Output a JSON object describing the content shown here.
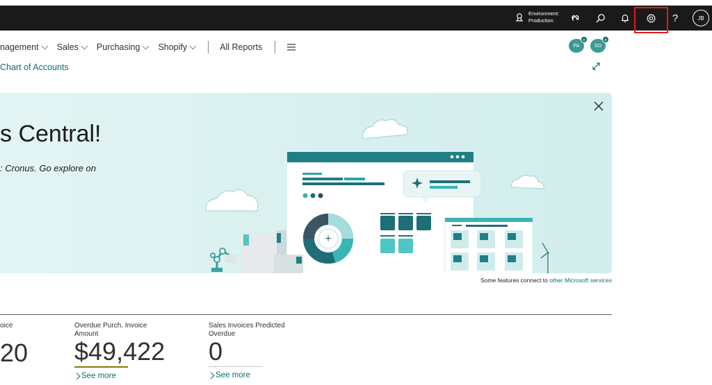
{
  "topbar": {
    "env_label": "Environment:",
    "env_value": "Production",
    "avatar_initials": "JB",
    "help_glyph": "?"
  },
  "nav": {
    "items": [
      {
        "label": "nagement"
      },
      {
        "label": "Sales"
      },
      {
        "label": "Purchasing"
      },
      {
        "label": "Shopify"
      }
    ],
    "all_reports": "All Reports",
    "sub_link": "Chart of Accounts"
  },
  "badges": [
    {
      "initials": "PA"
    },
    {
      "initials": "SO"
    }
  ],
  "banner": {
    "title": "s Central!",
    "subtitle": ": Cronus. Go explore on",
    "footnote_text": "Some features connect to ",
    "footnote_link": "other Microsoft services"
  },
  "tiles": [
    {
      "label_line1": "oice",
      "label_line2": "",
      "value": "20",
      "see_more": "",
      "bar_color": ""
    },
    {
      "label_line1": "Overdue Purch. Invoice",
      "label_line2": "Amount",
      "value": "$49,422",
      "see_more": "See more",
      "bar_color": "#8a7b00"
    },
    {
      "label_line1": "Sales Invoices Predicted",
      "label_line2": "Overdue",
      "value": "0",
      "see_more": "See more",
      "bar_color": "#c8c6c4"
    }
  ],
  "colors": {
    "topbar": "#1b1a19",
    "accent": "#0f6f6b",
    "highlight_box": "#e0191f",
    "banner_bg": "#d7f0ef"
  }
}
